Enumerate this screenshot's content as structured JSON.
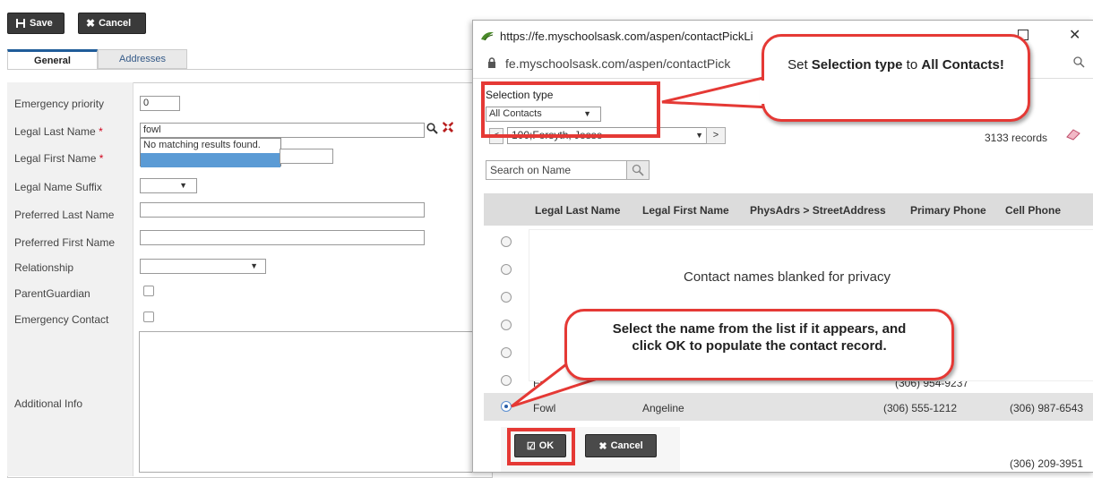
{
  "toolbar": {
    "save_label": "Save",
    "cancel_label": "Cancel"
  },
  "tabs": [
    {
      "label": "General",
      "active": true
    },
    {
      "label": "Addresses",
      "active": false
    }
  ],
  "form": {
    "emergency_priority": {
      "label": "Emergency priority",
      "value": "0"
    },
    "legal_last_name": {
      "label": "Legal Last Name",
      "value": "fowl",
      "required": "*"
    },
    "no_match_text": "No matching results found.",
    "legal_first_name": {
      "label": "Legal First Name",
      "required": "*"
    },
    "legal_name_suffix": {
      "label": "Legal Name Suffix"
    },
    "preferred_last_name": {
      "label": "Preferred Last Name"
    },
    "preferred_first_name": {
      "label": "Preferred First Name"
    },
    "relationship": {
      "label": "Relationship"
    },
    "parent_guardian": {
      "label": "ParentGuardian"
    },
    "emergency_contact": {
      "label": "Emergency Contact"
    },
    "additional_info": {
      "label": "Additional Info"
    }
  },
  "popup": {
    "title_url": "https://fe.myschoolsask.com/aspen/contactPickLi",
    "address_url": "fe.myschoolsask.com/aspen/contactPick",
    "selection_type_label": "Selection type",
    "selection_type_value": "All Contacts",
    "nav_select_value": "100;Forsyth, Jesse",
    "nav_next": ">",
    "records_count": "3133 records",
    "search_placeholder": "Search on Name",
    "columns": [
      "Legal Last Name",
      "Legal First Name",
      "PhysAdrs > StreetAddress",
      "Primary Phone",
      "Cell Phone"
    ],
    "privacy_text": "Contact names blanked for privacy",
    "partial_row_text": "Foster",
    "partial_row_phone": "(306) 954-9237",
    "selected_row": {
      "last": "Fowl",
      "first": "Angeline",
      "primary_phone": "(306) 555-1212",
      "cell_phone": "(306) 987-6543"
    },
    "bottom_row_phone": "(306) 209-3951",
    "ok_label": "OK",
    "cancel_label": "Cancel"
  },
  "callouts": {
    "selection_type": {
      "prefix": "Set ",
      "bold1": "Selection type",
      "middle": " to ",
      "bold2": "All Contacts!"
    },
    "select_name": "Select the name from the list if it appears, and click OK to populate the contact record."
  },
  "colors": {
    "accent_red": "#e53935",
    "tab_blue": "#1f5c99",
    "toolbar_dark": "#3a3a3a"
  }
}
